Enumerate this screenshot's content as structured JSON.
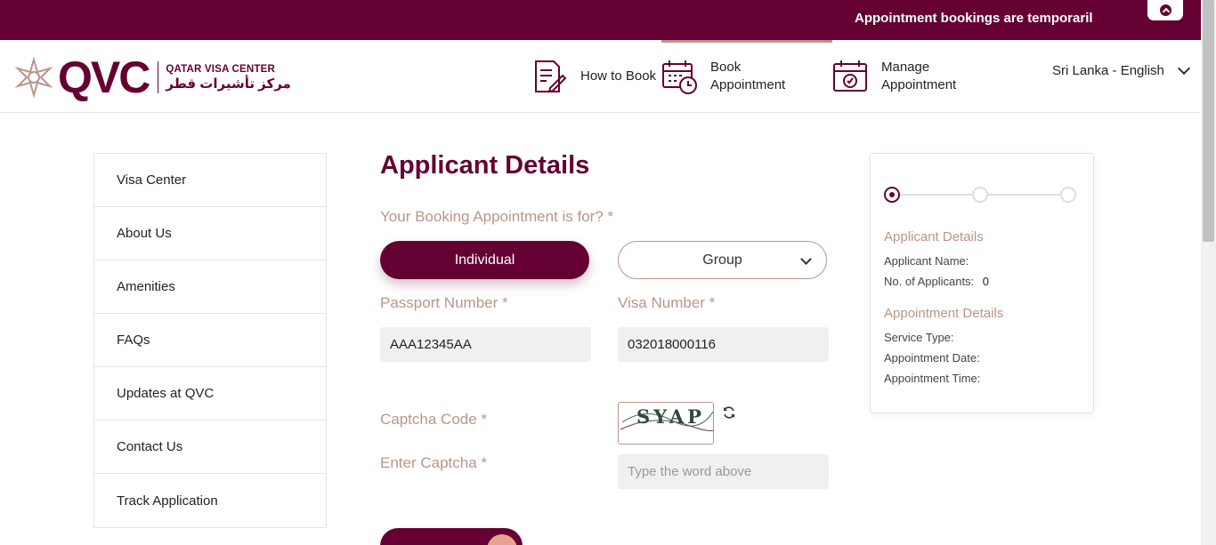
{
  "topbar": {
    "ticker": "Appointment bookings are temporaril",
    "colors": {
      "brand": "#650032",
      "accent": "#b9958a"
    }
  },
  "logo": {
    "wordmark": "QVC",
    "name_en": "QATAR VISA CENTER",
    "name_ar": "مركز تأشيرات قطر"
  },
  "nav": {
    "items": [
      {
        "label": "How to Book",
        "icon": "document-pen-icon"
      },
      {
        "label": "Book Appointment",
        "icon": "calendar-clock-icon"
      },
      {
        "label": "Manage Appointment",
        "icon": "calendar-check-icon"
      }
    ],
    "language": "Sri Lanka - English"
  },
  "sidebar": {
    "items": [
      {
        "label": "Visa Center"
      },
      {
        "label": "About Us"
      },
      {
        "label": "Amenities"
      },
      {
        "label": "FAQs"
      },
      {
        "label": "Updates at QVC"
      },
      {
        "label": "Contact Us"
      },
      {
        "label": "Track Application"
      }
    ]
  },
  "form": {
    "title": "Applicant Details",
    "booking_for_label": "Your Booking Appointment is for? *",
    "individual_label": "Individual",
    "group_label": "Group",
    "passport_label": "Passport Number *",
    "passport_value": "AAA12345AA",
    "visa_label": "Visa Number *",
    "visa_value": "032018000116",
    "captcha_label": "Captcha Code *",
    "captcha_text": "SYAP",
    "enter_captcha_label": "Enter Captcha *",
    "captcha_placeholder": "Type the word above"
  },
  "summary": {
    "steps": {
      "total": 3,
      "active": 1
    },
    "applicant_heading": "Applicant Details",
    "applicant_name_label": "Applicant Name:",
    "applicants_count_label": "No. of Applicants:",
    "applicants_count_value": "0",
    "appointment_heading": "Appointment Details",
    "service_type_label": "Service Type:",
    "appointment_date_label": "Appointment Date:",
    "appointment_time_label": "Appointment Time:"
  }
}
